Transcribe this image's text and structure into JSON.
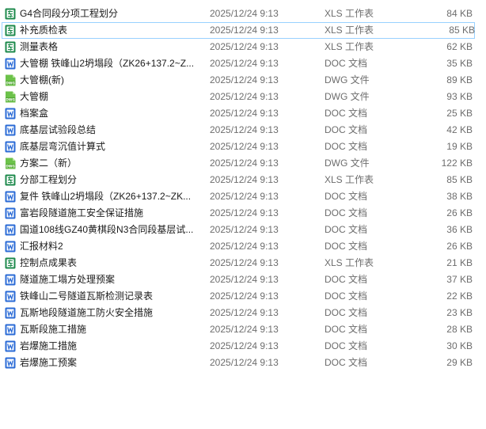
{
  "files": [
    {
      "name": "G4合同段分项工程划分",
      "date": "2025/12/24 9:13",
      "type": "XLS 工作表",
      "size": "84 KB",
      "icon": "xls-icon"
    },
    {
      "name": "补充质检表",
      "date": "2025/12/24 9:13",
      "type": "XLS 工作表",
      "size": "85 KB",
      "icon": "xls-icon",
      "selected": true
    },
    {
      "name": "测量表格",
      "date": "2025/12/24 9:13",
      "type": "XLS 工作表",
      "size": "62 KB",
      "icon": "xls-icon"
    },
    {
      "name": "大管棚 铁峰山2坍塌段（ZK26+137.2~Z...",
      "date": "2025/12/24 9:13",
      "type": "DOC 文档",
      "size": "35 KB",
      "icon": "doc-icon"
    },
    {
      "name": "大管棚(新)",
      "date": "2025/12/24 9:13",
      "type": "DWG 文件",
      "size": "89 KB",
      "icon": "dwg-icon"
    },
    {
      "name": "大管棚",
      "date": "2025/12/24 9:13",
      "type": "DWG 文件",
      "size": "93 KB",
      "icon": "dwg-icon"
    },
    {
      "name": "档案盒",
      "date": "2025/12/24 9:13",
      "type": "DOC 文档",
      "size": "25 KB",
      "icon": "doc-icon"
    },
    {
      "name": "底基层试验段总结",
      "date": "2025/12/24 9:13",
      "type": "DOC 文档",
      "size": "42 KB",
      "icon": "doc-icon"
    },
    {
      "name": "底基层弯沉值计算式",
      "date": "2025/12/24 9:13",
      "type": "DOC 文档",
      "size": "19 KB",
      "icon": "doc-icon"
    },
    {
      "name": "方案二（新）",
      "date": "2025/12/24 9:13",
      "type": "DWG 文件",
      "size": "122 KB",
      "icon": "dwg-icon"
    },
    {
      "name": "分部工程划分",
      "date": "2025/12/24 9:13",
      "type": "XLS 工作表",
      "size": "85 KB",
      "icon": "xls-icon"
    },
    {
      "name": "复件 铁峰山2坍塌段（ZK26+137.2~ZK...",
      "date": "2025/12/24 9:13",
      "type": "DOC 文档",
      "size": "38 KB",
      "icon": "doc-icon"
    },
    {
      "name": "富岩段隧道施工安全保证措施",
      "date": "2025/12/24 9:13",
      "type": "DOC 文档",
      "size": "26 KB",
      "icon": "doc-icon"
    },
    {
      "name": "国道108线GZ40黄棋段N3合同段基层试...",
      "date": "2025/12/24 9:13",
      "type": "DOC 文档",
      "size": "36 KB",
      "icon": "doc-icon"
    },
    {
      "name": "汇报材料2",
      "date": "2025/12/24 9:13",
      "type": "DOC 文档",
      "size": "26 KB",
      "icon": "doc-icon"
    },
    {
      "name": "控制点成果表",
      "date": "2025/12/24 9:13",
      "type": "XLS 工作表",
      "size": "21 KB",
      "icon": "xls-icon"
    },
    {
      "name": "隧道施工塌方处理预案",
      "date": "2025/12/24 9:13",
      "type": "DOC 文档",
      "size": "37 KB",
      "icon": "doc-icon"
    },
    {
      "name": "铁峰山二号隧道瓦斯检测记录表",
      "date": "2025/12/24 9:13",
      "type": "DOC 文档",
      "size": "22 KB",
      "icon": "doc-icon"
    },
    {
      "name": "瓦斯地段隧道施工防火安全措施",
      "date": "2025/12/24 9:13",
      "type": "DOC 文档",
      "size": "23 KB",
      "icon": "doc-icon"
    },
    {
      "name": "瓦斯段施工措施",
      "date": "2025/12/24 9:13",
      "type": "DOC 文档",
      "size": "28 KB",
      "icon": "doc-icon"
    },
    {
      "name": "岩爆施工措施",
      "date": "2025/12/24 9:13",
      "type": "DOC 文档",
      "size": "30 KB",
      "icon": "doc-icon"
    },
    {
      "name": "岩爆施工预案",
      "date": "2025/12/24 9:13",
      "type": "DOC 文档",
      "size": "29 KB",
      "icon": "doc-icon"
    }
  ],
  "colors": {
    "xls": "#1e8a4c",
    "doc": "#2b6bd6",
    "dwg": "#6cc24a",
    "selection_border": "#99d1ff"
  }
}
